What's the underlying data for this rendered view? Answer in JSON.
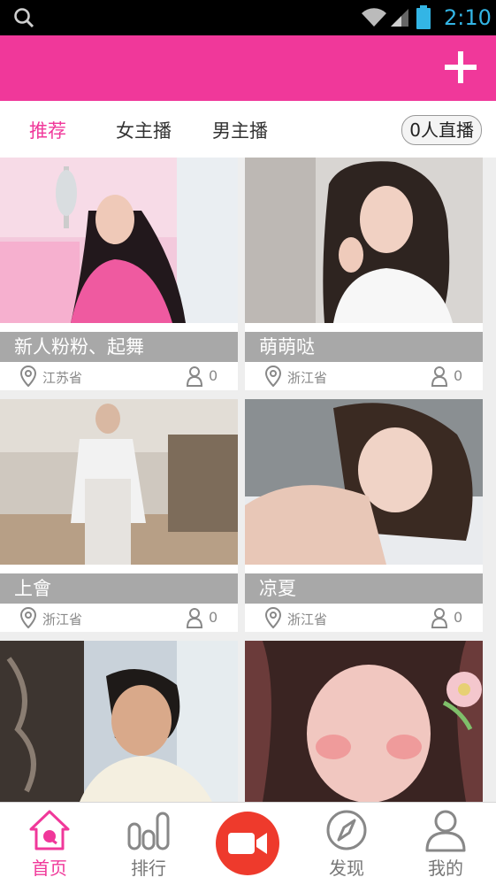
{
  "status_bar": {
    "time": "2:10",
    "icons": [
      "search-icon",
      "wifi-icon",
      "signal-icon",
      "battery-icon"
    ],
    "accent": "#33b5e5"
  },
  "header": {
    "background": "#f0389a",
    "action_icon": "plus-icon"
  },
  "tabs": [
    {
      "label": "推荐",
      "active": true
    },
    {
      "label": "女主播",
      "active": false
    },
    {
      "label": "男主播",
      "active": false
    }
  ],
  "live_count_label": "0人直播",
  "cards": [
    {
      "name": "新人粉粉、起舞",
      "location": "江苏省",
      "viewers": "0"
    },
    {
      "name": "萌萌哒",
      "location": "浙江省",
      "viewers": "0"
    },
    {
      "name": "上會",
      "location": "浙江省",
      "viewers": "0"
    },
    {
      "name": "凉夏",
      "location": "浙江省",
      "viewers": "0"
    },
    {
      "name": "",
      "location": "",
      "viewers": ""
    },
    {
      "name": "",
      "location": "",
      "viewers": ""
    }
  ],
  "bottom_nav": [
    {
      "label": "首页",
      "icon": "home-icon",
      "active": true
    },
    {
      "label": "排行",
      "icon": "ranking-icon",
      "active": false
    },
    {
      "label": "",
      "icon": "video-camera-icon",
      "active": false
    },
    {
      "label": "发现",
      "icon": "compass-icon",
      "active": false
    },
    {
      "label": "我的",
      "icon": "user-icon",
      "active": false
    }
  ],
  "colors": {
    "brand": "#f0389a",
    "camera": "#ee3a2c",
    "name_bar": "#a8a8a8"
  }
}
